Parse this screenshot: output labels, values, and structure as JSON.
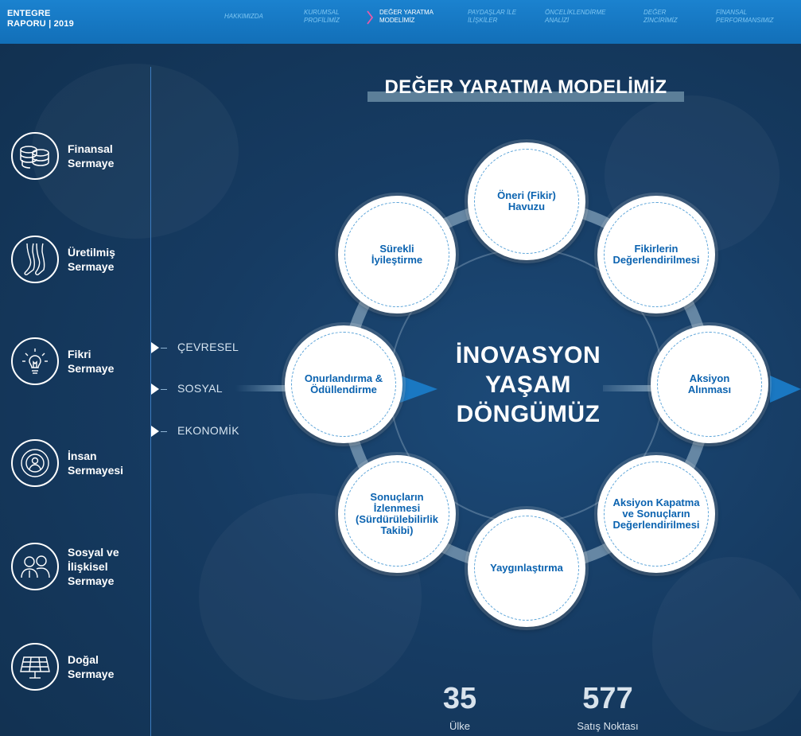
{
  "header": {
    "brand_line1": "ENTEGRE",
    "brand_line2": "RAPORU | 2019",
    "nav": [
      {
        "line1": "HAKKIMIZDA",
        "line2": ""
      },
      {
        "line1": "KURUMSAL",
        "line2": "PROFİLİMİZ"
      },
      {
        "line1": "DEĞER YARATMA",
        "line2": "MODELİMİZ"
      },
      {
        "line1": "PAYDAŞLAR İLE",
        "line2": "İLİŞKİLER"
      },
      {
        "line1": "ÖNCELİKLENDİRME",
        "line2": "ANALİZİ"
      },
      {
        "line1": "DEĞER",
        "line2": "ZİNCİRİMİZ"
      },
      {
        "line1": "FİNANSAL",
        "line2": "PERFORMANSIMIZ"
      }
    ]
  },
  "title": "DEĞER YARATMA MODELİMİZ",
  "capitals": [
    {
      "line1": "Finansal",
      "line2": "Sermaye",
      "line3": "",
      "icon": "coins-icon"
    },
    {
      "line1": "Üretilmiş",
      "line2": "Sermaye",
      "line3": "",
      "icon": "legwear-icon"
    },
    {
      "line1": "Fikri",
      "line2": "Sermaye",
      "line3": "",
      "icon": "lightbulb-icon"
    },
    {
      "line1": "İnsan",
      "line2": "Sermayesi",
      "line3": "",
      "icon": "person-target-icon"
    },
    {
      "line1": "Sosyal ve",
      "line2": "İlişkisel",
      "line3": "Sermaye",
      "icon": "people-icon"
    },
    {
      "line1": "Doğal",
      "line2": "Sermaye",
      "line3": "",
      "icon": "solar-panel-icon"
    }
  ],
  "pillars": [
    "ÇEVRESEL",
    "SOSYAL",
    "EKONOMİK"
  ],
  "cycle": {
    "center_line1": "İNOVASYON",
    "center_line2": "YAŞAM",
    "center_line3": "DÖNGÜMÜZ",
    "stages": [
      {
        "line1": "Öneri (Fikir)",
        "line2": "Havuzu",
        "line3": "",
        "line4": ""
      },
      {
        "line1": "Fikirlerin",
        "line2": "Değerlendirilmesi",
        "line3": "",
        "line4": ""
      },
      {
        "line1": "Aksiyon",
        "line2": "Alınması",
        "line3": "",
        "line4": ""
      },
      {
        "line1": "Aksiyon Kapatma",
        "line2": "ve Sonuçların",
        "line3": "Değerlendirilmesi",
        "line4": ""
      },
      {
        "line1": "Yaygınlaştırma",
        "line2": "",
        "line3": "",
        "line4": ""
      },
      {
        "line1": "Sonuçların",
        "line2": "İzlenmesi",
        "line3": "(Sürdürülebilirlik",
        "line4": "Takibi)"
      },
      {
        "line1": "Onurlandırma &",
        "line2": "Ödüllendirme",
        "line3": "",
        "line4": ""
      },
      {
        "line1": "Sürekli",
        "line2": "İyileştirme",
        "line3": "",
        "line4": ""
      }
    ]
  },
  "stats": [
    {
      "value": "35",
      "label": "Ülke"
    },
    {
      "value": "577",
      "label": "Satış Noktası"
    }
  ],
  "colors": {
    "accent": "#0b63b0",
    "header": "#1878c6",
    "nav_inactive": "#7ec6f2",
    "chevron": "#e85aa8"
  }
}
